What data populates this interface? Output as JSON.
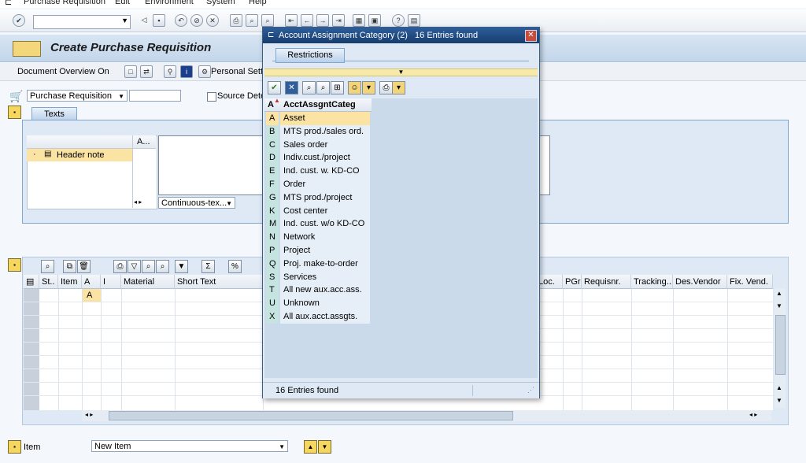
{
  "menu": [
    "Purchase Requisition",
    "Edit",
    "Environment",
    "System",
    "Help"
  ],
  "title": "Create Purchase Requisition",
  "app_toolbar": {
    "doc_overview": "Document Overview On",
    "personal_settings": "Personal Setti"
  },
  "header": {
    "doc_type": "Purchase Requisition",
    "source_determination": "Source Dete"
  },
  "texts_tab": "Texts",
  "tree": {
    "col": "A...",
    "item": "Header note"
  },
  "editor_mode": "Continuous-tex...",
  "grid": {
    "columns": [
      "St..",
      "Item",
      "A",
      "I",
      "Material",
      "Short Text",
      "Loc.",
      "PGr",
      "Requisnr.",
      "Tracking...",
      "Des.Vendor",
      "Fix. Vend."
    ],
    "first_row_a": "A"
  },
  "footer": {
    "item_label": "Item",
    "item_select": "New Item"
  },
  "popup": {
    "title": "Account Assignment Category (2)   16 Entries found",
    "tab": "Restrictions",
    "col_key": "A",
    "col_text": "AcctAssgntCateg",
    "rows": [
      {
        "k": "A",
        "t": "Asset"
      },
      {
        "k": "B",
        "t": "MTS prod./sales ord."
      },
      {
        "k": "C",
        "t": "Sales order"
      },
      {
        "k": "D",
        "t": "Indiv.cust./project"
      },
      {
        "k": "E",
        "t": "Ind. cust. w. KD-CO"
      },
      {
        "k": "F",
        "t": "Order"
      },
      {
        "k": "G",
        "t": "MTS prod./project"
      },
      {
        "k": "K",
        "t": "Cost center"
      },
      {
        "k": "M",
        "t": "Ind. cust. w/o KD-CO"
      },
      {
        "k": "N",
        "t": "Network"
      },
      {
        "k": "P",
        "t": "Project"
      },
      {
        "k": "Q",
        "t": "Proj. make-to-order"
      },
      {
        "k": "S",
        "t": "Services"
      },
      {
        "k": "T",
        "t": "All new aux.acc.ass."
      },
      {
        "k": "U",
        "t": "Unknown"
      },
      {
        "k": "X",
        "t": "All aux.acct.assgts."
      }
    ],
    "status": "16 Entries found"
  }
}
